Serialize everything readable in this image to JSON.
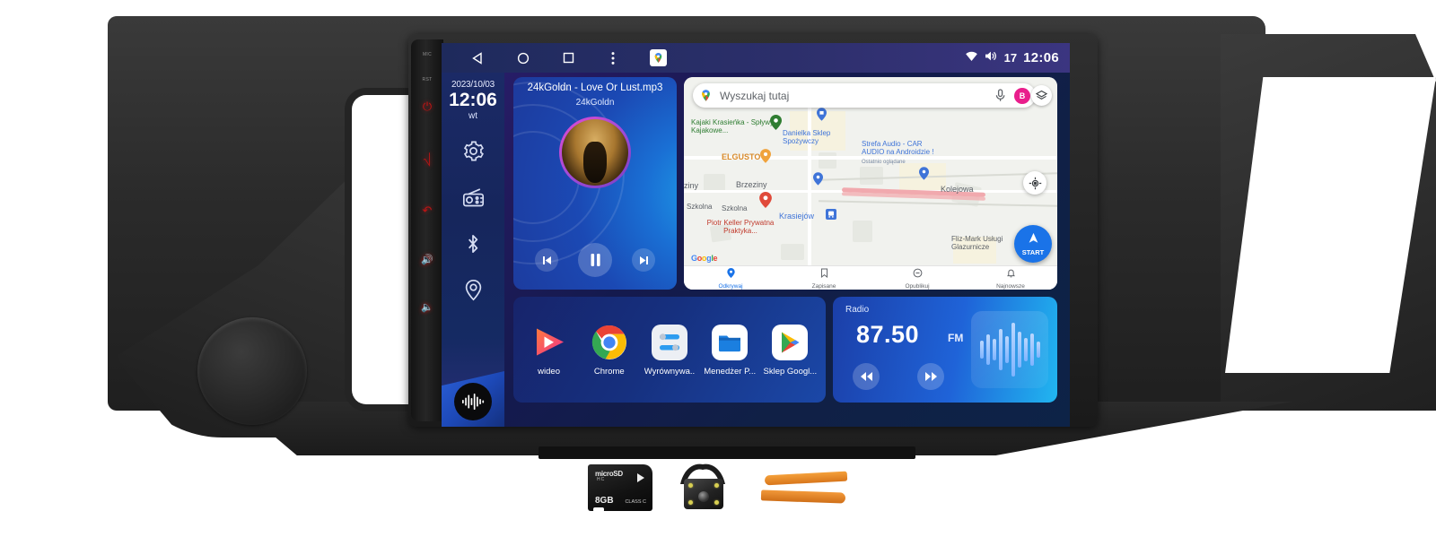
{
  "product": {
    "type": "android-car-head-unit",
    "fascia_color": "#2e2e2e"
  },
  "screen": {
    "statusbar": {
      "nav_back_icon": "back-triangle-icon",
      "nav_home_icon": "home-circle-icon",
      "nav_recents_icon": "recents-square-icon",
      "nav_menu_icon": "overflow-menu-icon",
      "maps_shortcut_icon": "google-maps-icon",
      "wifi_icon": "wifi-icon",
      "volume_icon": "volume-icon",
      "volume_level": "17",
      "time": "12:06"
    },
    "rail": {
      "date": "2023/10/03",
      "time": "12:06",
      "day": "wt",
      "items": [
        {
          "name": "settings",
          "icon": "gear-icon"
        },
        {
          "name": "radio",
          "icon": "radio-icon"
        },
        {
          "name": "bluetooth",
          "icon": "bluetooth-icon"
        },
        {
          "name": "navigation",
          "icon": "location-pin-icon"
        }
      ],
      "voice_icon": "voice-waveform-icon"
    },
    "music": {
      "title": "24kGoldn - Love Or Lust.mp3",
      "artist": "24kGoldn",
      "prev_icon": "skip-previous-icon",
      "play_icon": "pause-icon",
      "next_icon": "skip-next-icon"
    },
    "map": {
      "search_placeholder": "Wyszukaj tutaj",
      "mic_icon": "microphone-icon",
      "avatar_letter": "B",
      "layers_icon": "map-layers-icon",
      "recenter_icon": "recenter-target-icon",
      "start_label": "START",
      "start_icon": "navigation-arrow-icon",
      "watermark": "Google",
      "labels": [
        {
          "text": "Kajaki Krasieńka - Spływy Kajakowe...",
          "color": "#2f7d32"
        },
        {
          "text": "Danielka Sklep Spożywczy",
          "color": "#3f74d8"
        },
        {
          "text": "Strefa Audio - CAR AUDIO na Androidzie !",
          "color": "#3f74d8"
        },
        {
          "text": "Ostatnio oglądane",
          "color": "#7a8aa3"
        },
        {
          "text": "ELGUSTO",
          "color": "#d98b2b"
        },
        {
          "text": "Brzeziny",
          "color": "#5a5f66"
        },
        {
          "text": "ziny",
          "color": "#5a5f66"
        },
        {
          "text": "Szkolna",
          "color": "#5a5f66"
        },
        {
          "text": "Szkolna",
          "color": "#5a5f66"
        },
        {
          "text": "Kolejowa",
          "color": "#5a5f66"
        },
        {
          "text": "Krasiejów",
          "color": "#3f74d8"
        },
        {
          "text": "Piotr Keller Prywatna Praktyka...",
          "color": "#c0392b"
        },
        {
          "text": "Fliz-Mark Usługi Glazurnicze",
          "color": "#5a5f66"
        }
      ],
      "bottom_nav": [
        {
          "label": "Odkrywaj",
          "icon": "explore-pin-icon",
          "active": true
        },
        {
          "label": "Zapisane",
          "icon": "bookmark-icon",
          "active": false
        },
        {
          "label": "Opublikuj",
          "icon": "contribute-icon",
          "active": false
        },
        {
          "label": "Najnowsze",
          "icon": "bell-icon",
          "active": false
        }
      ]
    },
    "apps": [
      {
        "label": "wideo",
        "icon": "video-play-icon"
      },
      {
        "label": "Chrome",
        "icon": "chrome-icon"
      },
      {
        "label": "Wyrównywa..",
        "icon": "equalizer-icon"
      },
      {
        "label": "Menedżer P...",
        "icon": "file-manager-icon"
      },
      {
        "label": "Sklep Googl...",
        "icon": "play-store-icon"
      }
    ],
    "radio": {
      "label": "Radio",
      "frequency": "87.50",
      "band": "FM",
      "prev_icon": "rewind-icon",
      "next_icon": "fast-forward-icon",
      "visual_icon": "audio-waveform-icon"
    }
  },
  "hardkeys": {
    "mic_label": "MIC",
    "rst_label": "RST",
    "buttons": [
      {
        "name": "power",
        "icon": "power-icon"
      },
      {
        "name": "home",
        "icon": "home-icon"
      },
      {
        "name": "back",
        "icon": "back-arrow-icon"
      },
      {
        "name": "volume-up",
        "icon": "volume-up-icon"
      },
      {
        "name": "volume-down",
        "icon": "volume-down-icon"
      }
    ]
  },
  "accessories": [
    {
      "name": "microsd-card",
      "capacity": "8GB",
      "brand": "microSD",
      "class": "CLASS C"
    },
    {
      "name": "rear-view-camera"
    },
    {
      "name": "pry-tool-1"
    },
    {
      "name": "pry-tool-2"
    }
  ]
}
